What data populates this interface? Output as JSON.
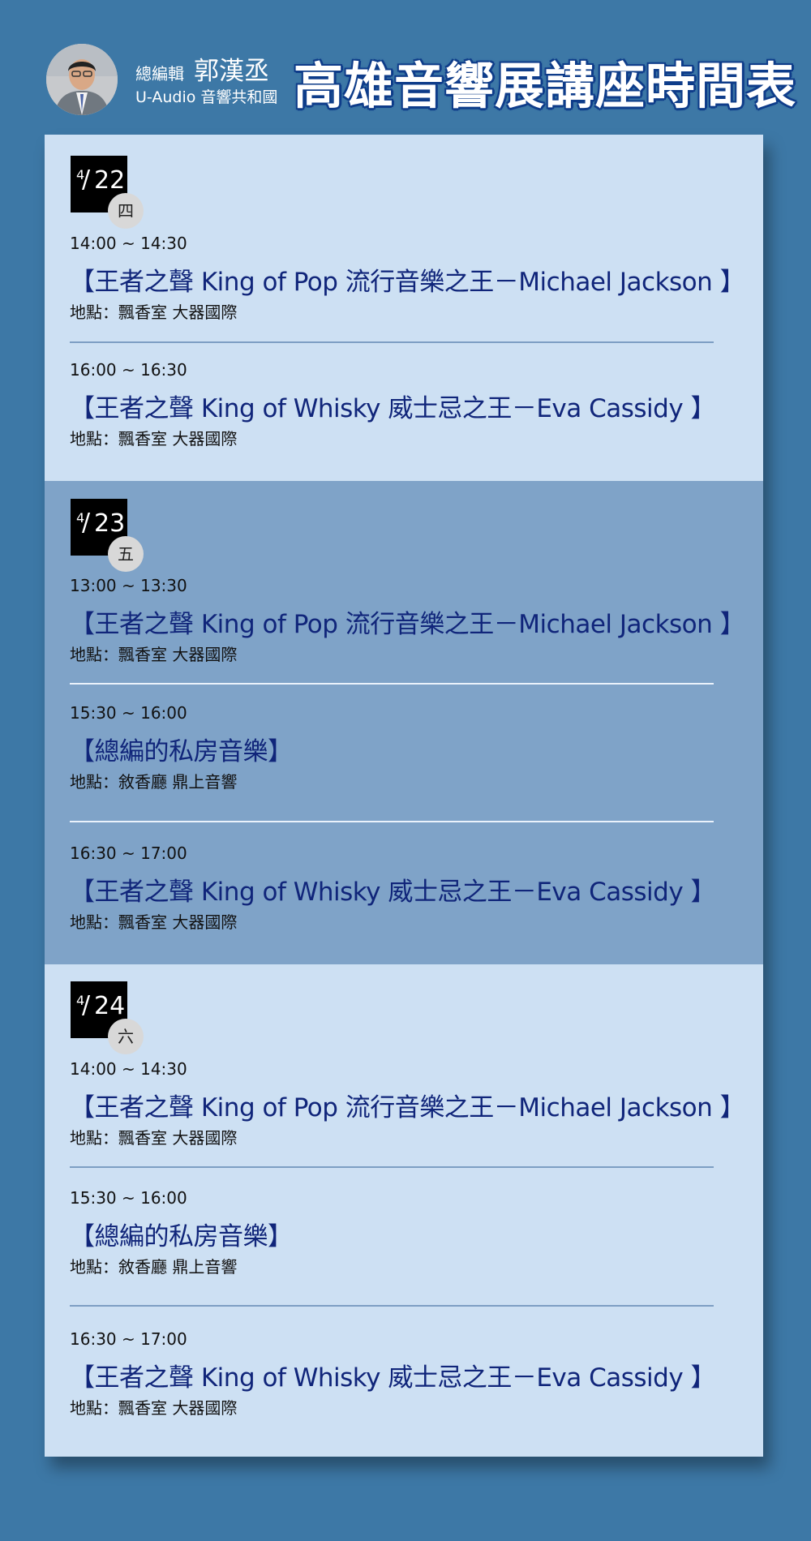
{
  "header": {
    "editor_role": "總編輯",
    "editor_name": "郭漢丞",
    "editor_org": "U-Audio 音響共和國",
    "title": "高雄音響展講座時間表"
  },
  "days": [
    {
      "month": "4",
      "day": "22",
      "weekday": "四",
      "events": [
        {
          "time": "14:00 ~ 14:30",
          "title": "【王者之聲 King of Pop 流行音樂之王－Michael Jackson 】",
          "venue": "地點：飄香室  大器國際"
        },
        {
          "time": "16:00 ~ 16:30",
          "title": "【王者之聲 King of Whisky 威士忌之王－Eva Cassidy 】",
          "venue": "地點：飄香室  大器國際"
        }
      ]
    },
    {
      "month": "4",
      "day": "23",
      "weekday": "五",
      "events": [
        {
          "time": "13:00 ~ 13:30",
          "title": "【王者之聲 King of Pop 流行音樂之王－Michael Jackson 】",
          "venue": "地點：飄香室  大器國際"
        },
        {
          "time": "15:30 ~ 16:00",
          "title": "【總編的私房音樂】",
          "venue": "地點：敘香廳  鼎上音響"
        },
        {
          "time": "16:30 ~ 17:00",
          "title": "【王者之聲 King of Whisky 威士忌之王－Eva Cassidy 】",
          "venue": "地點：飄香室  大器國際"
        }
      ]
    },
    {
      "month": "4",
      "day": "24",
      "weekday": "六",
      "events": [
        {
          "time": "14:00 ~ 14:30",
          "title": "【王者之聲 King of Pop 流行音樂之王－Michael Jackson 】",
          "venue": "地點：飄香室  大器國際"
        },
        {
          "time": "15:30 ~ 16:00",
          "title": "【總編的私房音樂】",
          "venue": "地點：敘香廳  鼎上音響"
        },
        {
          "time": "16:30 ~ 17:00",
          "title": "【王者之聲 King of Whisky 威士忌之王－Eva Cassidy 】",
          "venue": "地點：飄香室  大器國際"
        }
      ]
    }
  ],
  "colors": {
    "background": "#3d78a6",
    "panel_light": "#cde0f3",
    "panel_dark": "#7fa3c8",
    "title_text": "#10257a"
  }
}
